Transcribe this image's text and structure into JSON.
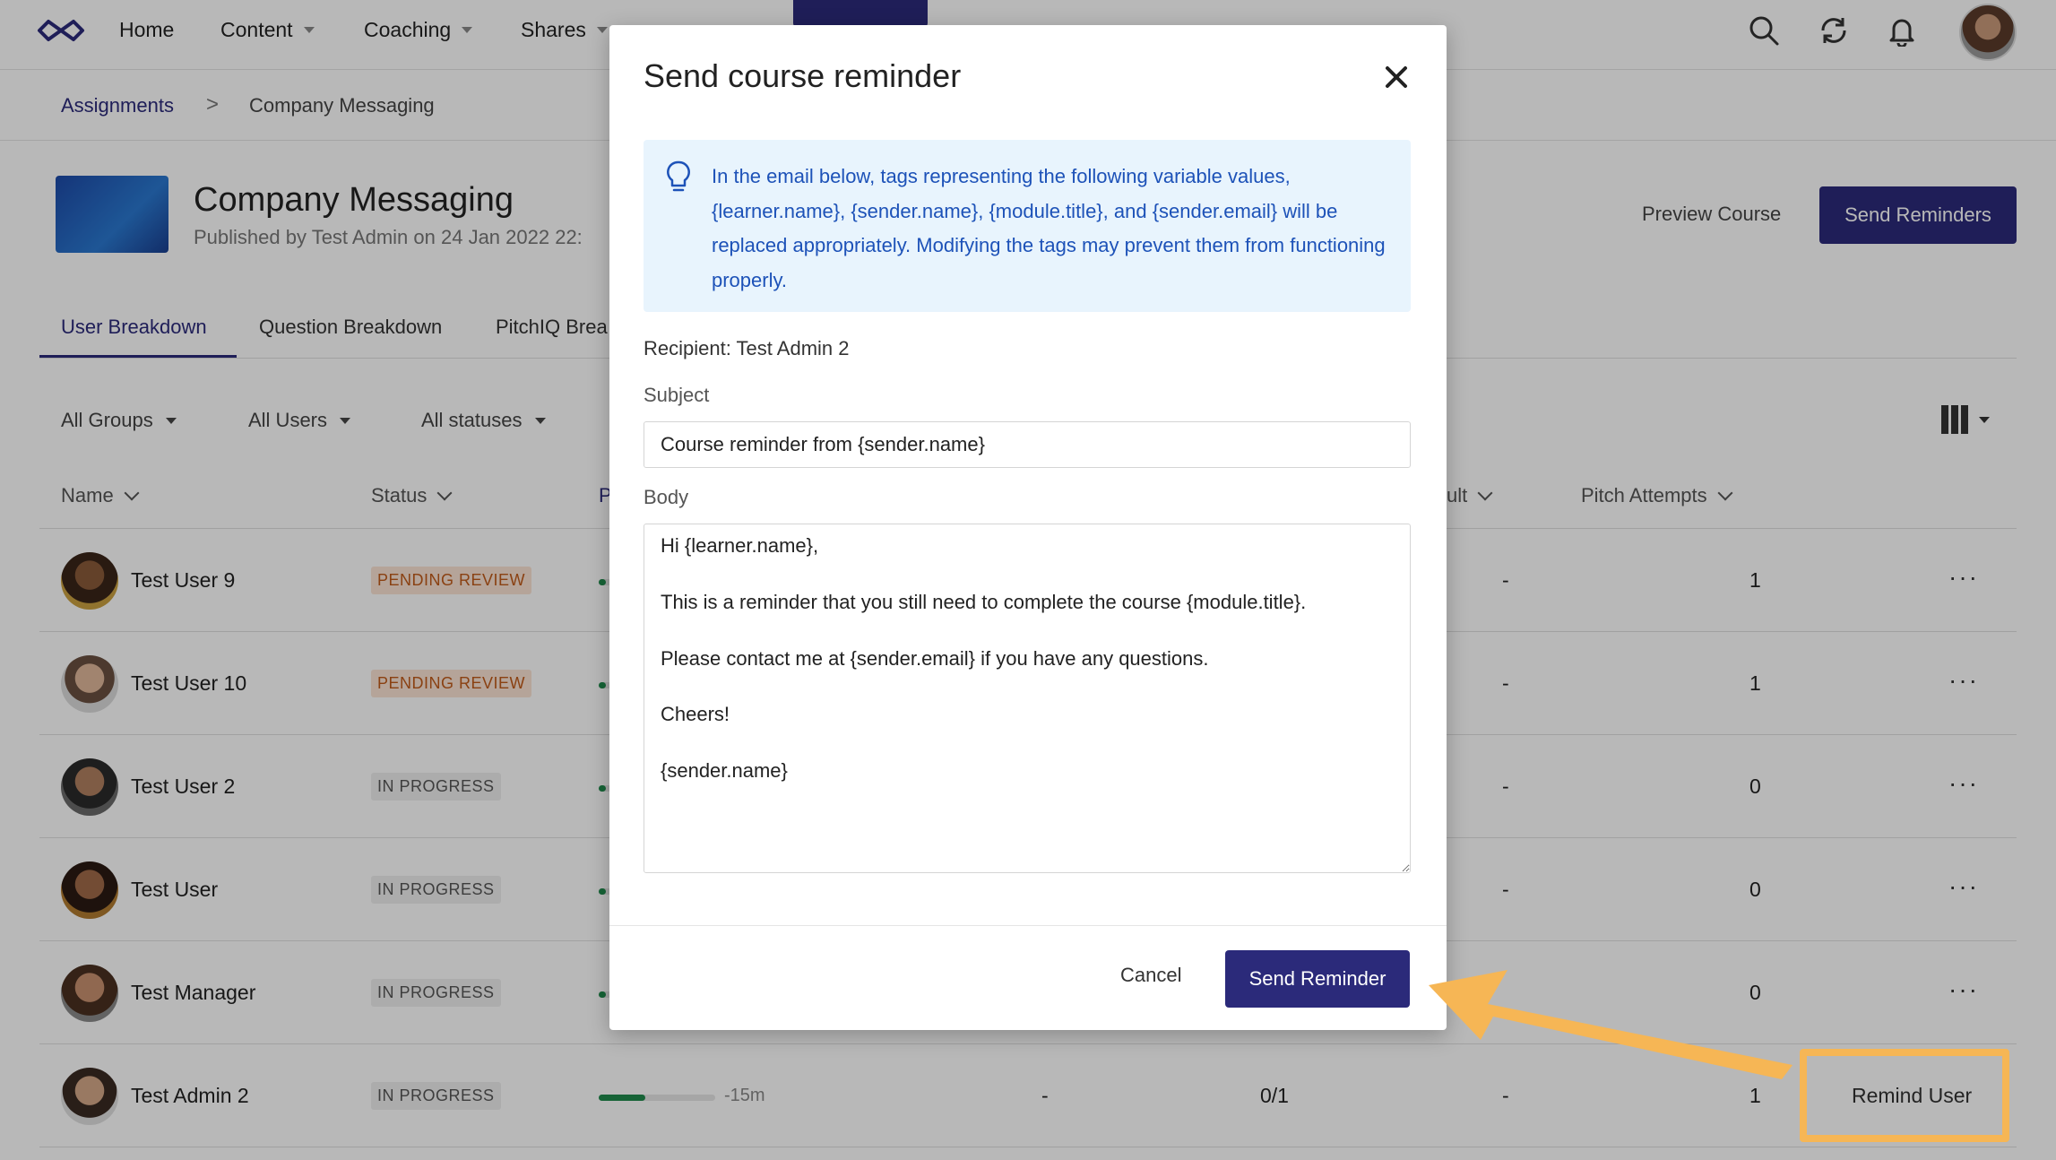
{
  "topnav": {
    "items": [
      {
        "label": "Home",
        "has_caret": false
      },
      {
        "label": "Content",
        "has_caret": true
      },
      {
        "label": "Coaching",
        "has_caret": true
      },
      {
        "label": "Shares",
        "has_caret": true
      }
    ],
    "icons": [
      "search-icon",
      "sync-icon",
      "bell-icon"
    ]
  },
  "breadcrumb": {
    "parent": "Assignments",
    "separator": ">",
    "current": "Company Messaging"
  },
  "course": {
    "title": "Company Messaging",
    "subtitle": "Published by Test Admin on 24 Jan 2022 22:",
    "preview_label": "Preview Course",
    "send_reminders_label": "Send Reminders"
  },
  "tabs": [
    "User Breakdown",
    "Question Breakdown",
    "PitchIQ Brea"
  ],
  "filters": [
    "All Groups",
    "All Users",
    "All statuses"
  ],
  "table": {
    "headers": {
      "name": "Name",
      "status": "Status",
      "p": "P",
      "result": "ult",
      "attempts": "Pitch Attempts"
    },
    "rows": [
      {
        "name": "Test User 9",
        "status": "PENDING REVIEW",
        "status_type": "pending",
        "dash1": "",
        "score": "",
        "dash2": "-",
        "attempts": "1",
        "action": "···"
      },
      {
        "name": "Test User 10",
        "status": "PENDING REVIEW",
        "status_type": "pending",
        "dash1": "",
        "score": "",
        "dash2": "-",
        "attempts": "1",
        "action": "···"
      },
      {
        "name": "Test User 2",
        "status": "IN PROGRESS",
        "status_type": "progress",
        "dash1": "",
        "score": "",
        "dash2": "-",
        "attempts": "0",
        "action": "···"
      },
      {
        "name": "Test User",
        "status": "IN PROGRESS",
        "status_type": "progress",
        "dash1": "",
        "score": "",
        "dash2": "-",
        "attempts": "0",
        "action": "···"
      },
      {
        "name": "Test Manager",
        "status": "IN PROGRESS",
        "status_type": "progress",
        "dash1": "",
        "score": "",
        "dash2": "",
        "attempts": "0",
        "action": "···"
      },
      {
        "name": "Test Admin 2",
        "status": "IN PROGRESS",
        "status_type": "progress",
        "time": "-15m",
        "dash1": "-",
        "score": "0/1",
        "dash2": "-",
        "attempts": "1",
        "action": "Remind User"
      }
    ]
  },
  "modal": {
    "title": "Send course reminder",
    "info": "In the email below, tags representing the following variable values, {learner.name}, {sender.name}, {module.title}, and {sender.email} will be replaced appropriately. Modifying the tags may prevent them from functioning properly.",
    "recipient": "Recipient: Test Admin 2",
    "subject_label": "Subject",
    "subject_value": "Course reminder from {sender.name}",
    "body_label": "Body",
    "body_value": "Hi {learner.name},\n\nThis is a reminder that you still need to complete the course {module.title}.\n\nPlease contact me at {sender.email} if you have any questions.\n\nCheers!\n\n{sender.name}",
    "cancel_label": "Cancel",
    "send_label": "Send Reminder"
  },
  "colors": {
    "brand": "#2b2a7a",
    "annotation": "#f6b655",
    "info_bg": "#e8f4fd",
    "info_text": "#1d52b8"
  }
}
